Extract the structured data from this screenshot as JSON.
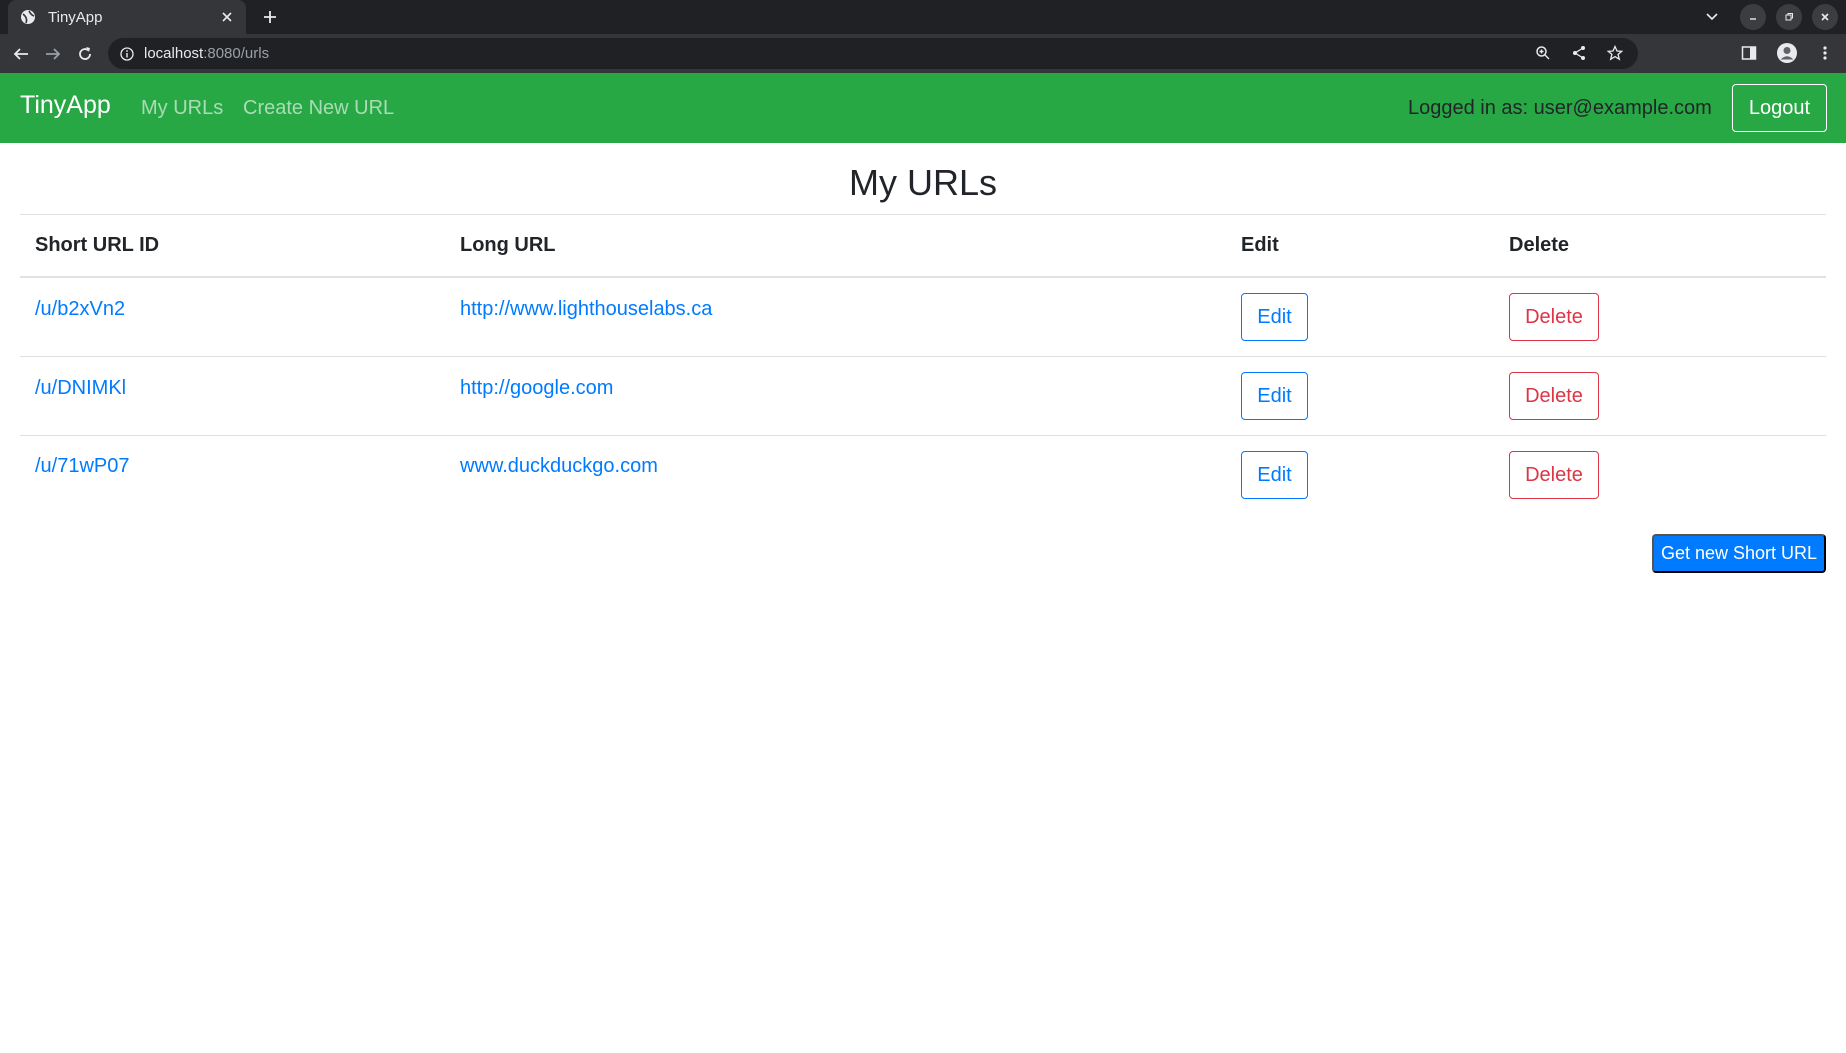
{
  "browser": {
    "tab_title": "TinyApp",
    "url_host": "localhost",
    "url_path": ":8080/urls"
  },
  "nav": {
    "brand": "TinyApp",
    "links": [
      "My URLs",
      "Create New URL"
    ],
    "logged_in": "Logged in as: user@example.com",
    "logout": "Logout"
  },
  "main": {
    "title": "My URLs",
    "columns": [
      "Short URL ID",
      "Long URL",
      "Edit",
      "Delete"
    ],
    "rows": [
      {
        "short": "/u/b2xVn2",
        "long": "http://www.lighthouselabs.ca",
        "edit": "Edit",
        "delete": "Delete"
      },
      {
        "short": "/u/DNIMKl",
        "long": "http://google.com",
        "edit": "Edit",
        "delete": "Delete"
      },
      {
        "short": "/u/71wP07",
        "long": "www.duckduckgo.com",
        "edit": "Edit",
        "delete": "Delete"
      }
    ],
    "new_button": "Get new Short URL"
  },
  "colors": {
    "navbar": "#28a745",
    "link": "#007bff",
    "danger": "#dc3545",
    "primary": "#007bff"
  }
}
